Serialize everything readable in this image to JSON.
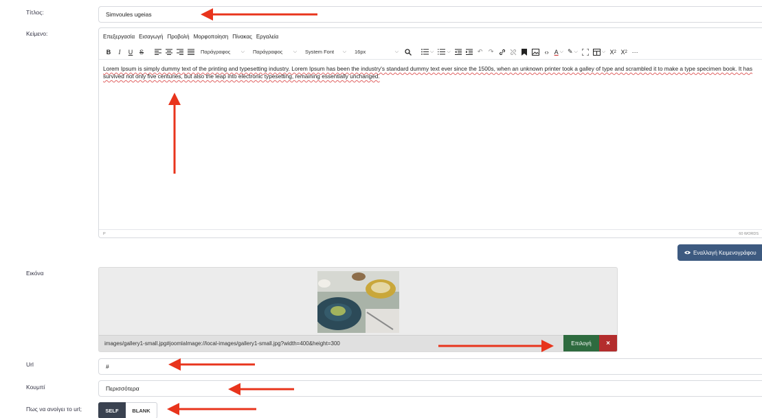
{
  "labels": {
    "title": "Τίτλος:",
    "text": "Κείμενο:",
    "image": "Εικόνα",
    "url": "Url",
    "button": "Κουμπί",
    "open_mode": "Πως να ανοίγει το url;"
  },
  "title_value": "Simvoules ugeias",
  "editor": {
    "menu": [
      "Επεξεργασία",
      "Εισαγωγή",
      "Προβολή",
      "Μορφοποίηση",
      "Πίνακας",
      "Εργαλεία"
    ],
    "toolbar": {
      "bold": "B",
      "italic": "I",
      "underline": "U",
      "strike": "S",
      "block_format": "Παράγραφος",
      "paragraph_format": "Παράγραφος",
      "font_family": "System Font",
      "font_size": "16px"
    },
    "content": "Lorem Ipsum is simply dummy text of the printing and typesetting industry. Lorem Ipsum has been the industry's standard dummy text ever since the 1500s, when an unknown printer took a galley of type and scrambled it to make a type specimen book. It has survived not only five centuries, but also the leap into electronic typesetting, remaining essentially unchanged.",
    "status_path": "P",
    "word_count": "60 WORDS"
  },
  "toggle_editor_label": "Εναλλαγή Κειμενογράφου",
  "image_field": {
    "path": "images/gallery1-small.jpg#joomlaImage://local-images/gallery1-small.jpg?width=400&height=300",
    "select_label": "Επιλογή",
    "clear_label": "×"
  },
  "url_value": "#",
  "button_value": "Περισσότερα",
  "open_mode": {
    "options": [
      "SELF",
      "BLANK"
    ],
    "selected": "SELF"
  },
  "colors": {
    "arrow": "#e8341c",
    "toggle_button": "#3d5a80",
    "select_button": "#2e6b3f",
    "clear_button": "#b32d2d",
    "radio_selected": "#3a4250"
  }
}
